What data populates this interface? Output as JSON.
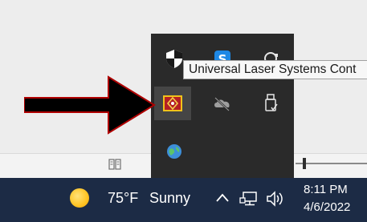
{
  "tooltip": {
    "text": "Universal Laser Systems Cont"
  },
  "tray_flyout": {
    "icons": [
      "windows-security-icon",
      "skype-icon",
      "sync-icon",
      "universal-laser-systems-icon",
      "onedrive-offline-icon",
      "usb-eject-icon",
      "globe-app-icon"
    ],
    "selected_icon": "universal-laser-systems-icon"
  },
  "annotation": {
    "arrow_color": "#000000",
    "arrow_outline": "#b00000"
  },
  "taskbar": {
    "background": "#1c2b45",
    "weather": {
      "icon": "sun-icon",
      "temperature": "75°F",
      "condition": "Sunny"
    },
    "system_icons": [
      "chevron-up-icon",
      "network-icon",
      "volume-icon"
    ],
    "clock": {
      "time": "8:11 PM",
      "date": "4/6/2022"
    }
  }
}
